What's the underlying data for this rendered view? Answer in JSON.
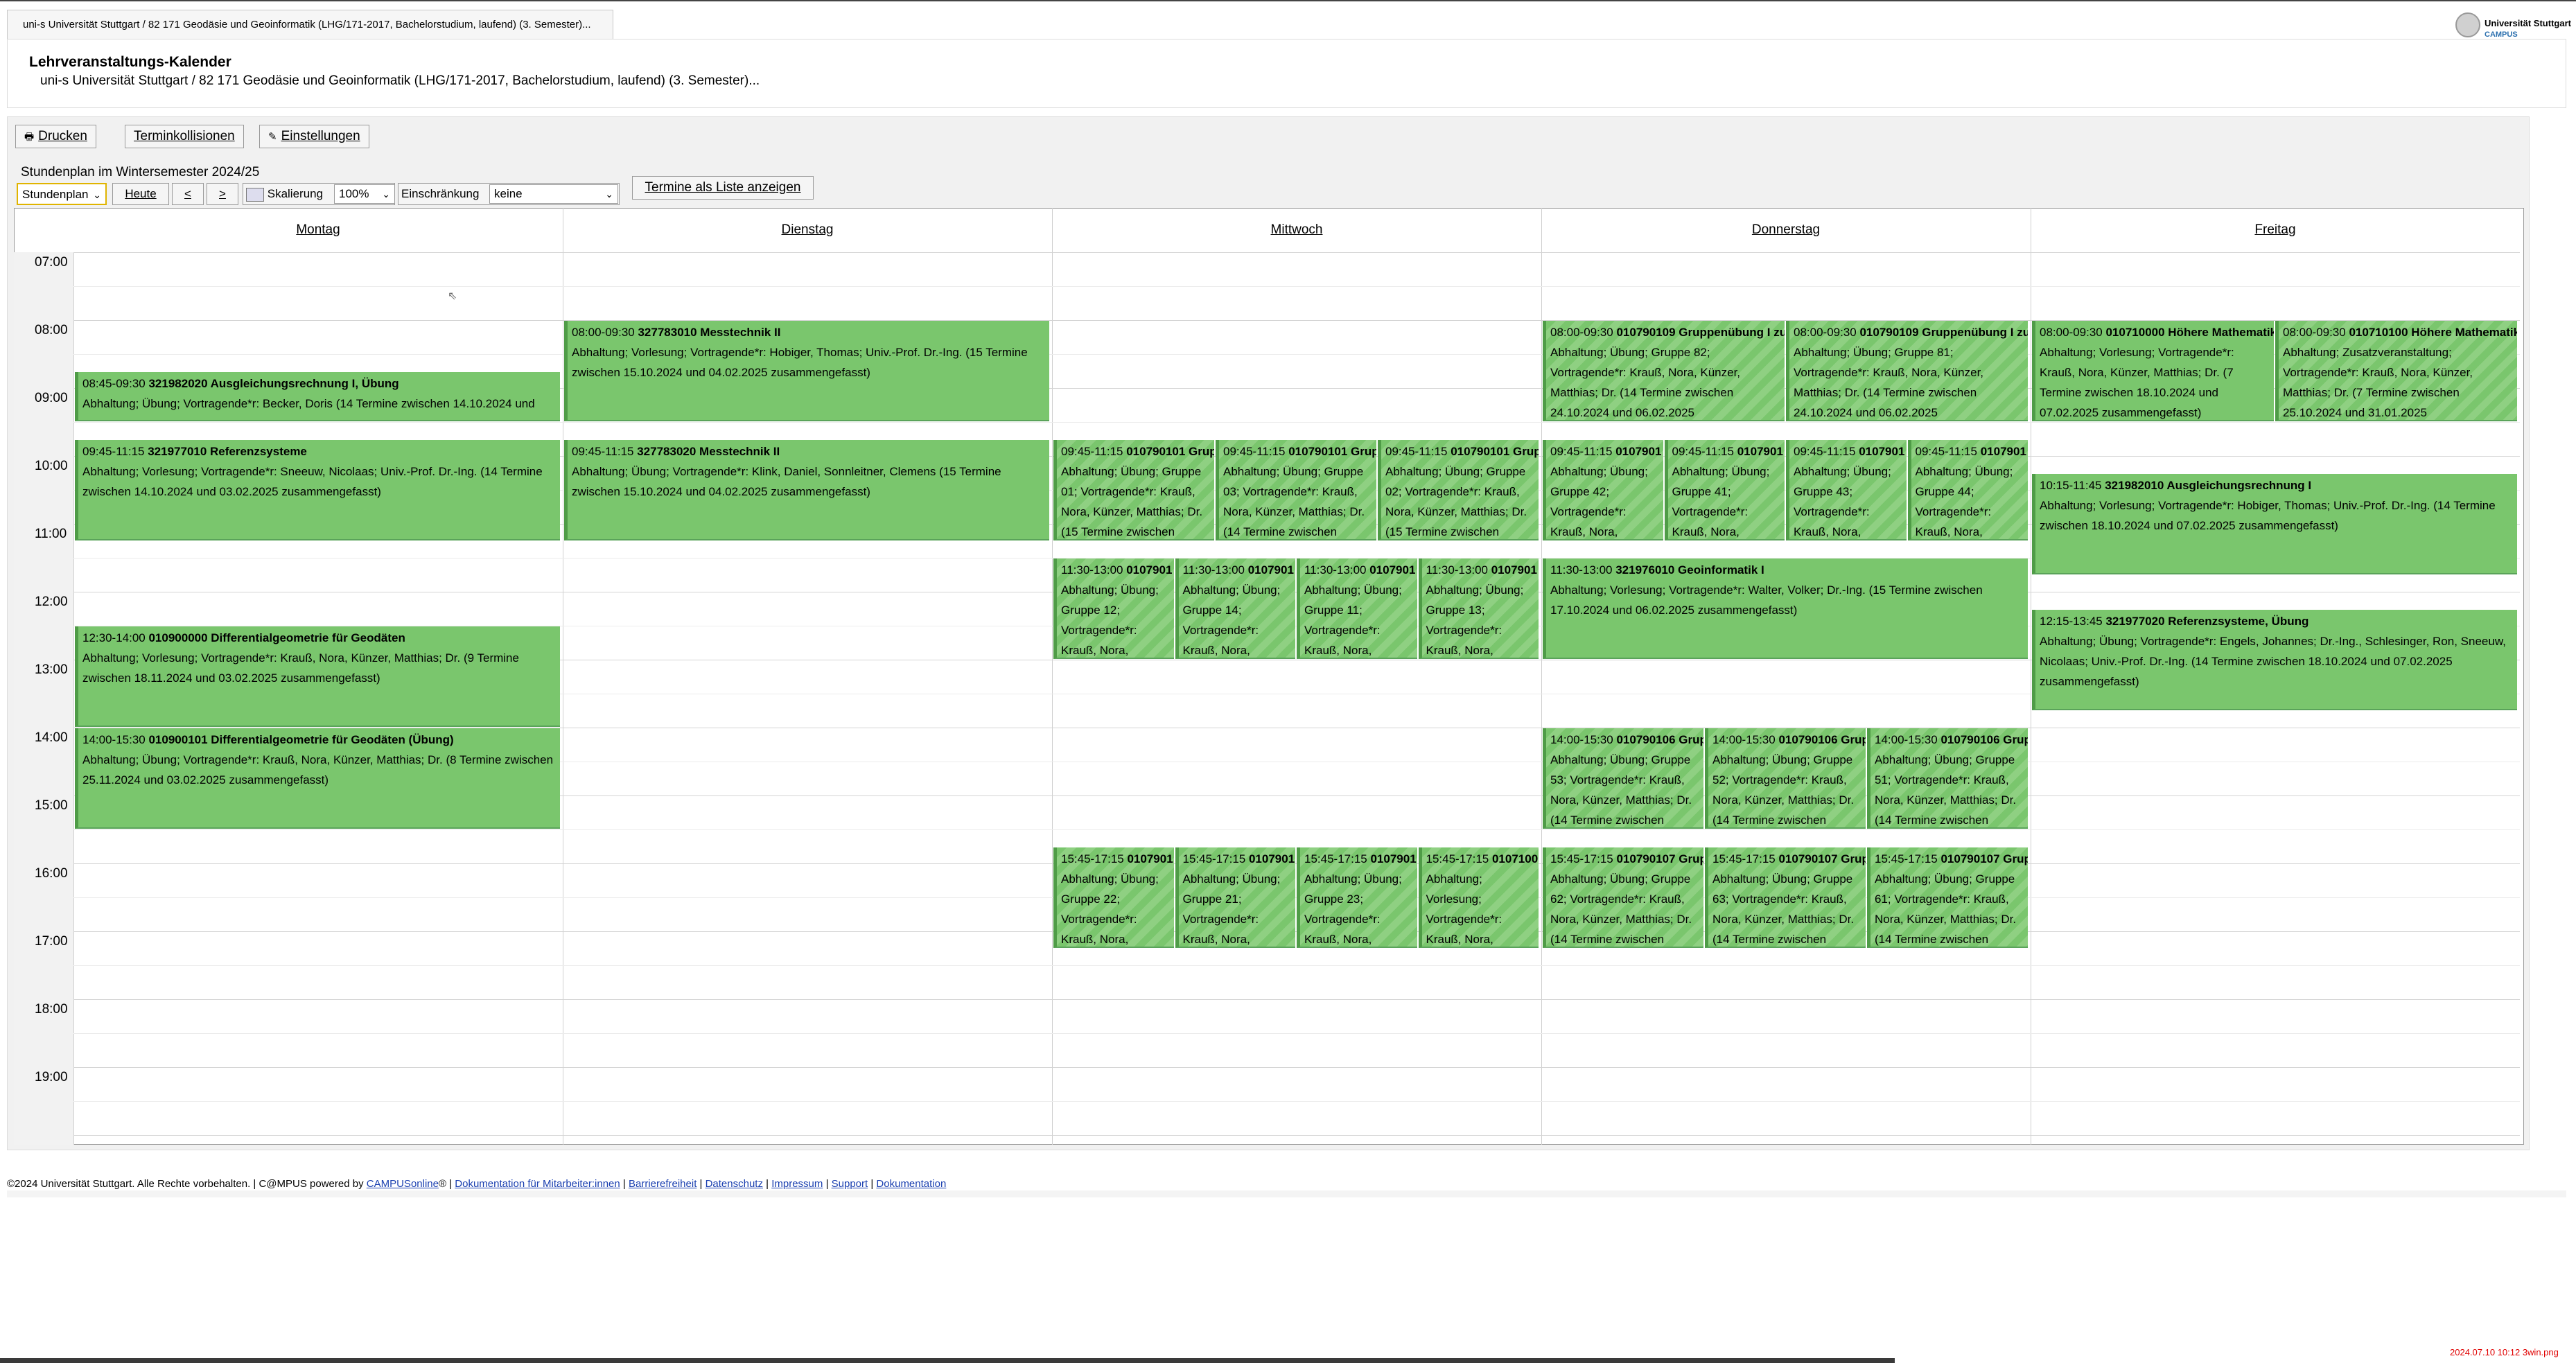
{
  "browser": {
    "tab_title": "uni-s Universität Stuttgart / 82 171 Geodäsie und Geoinformatik (LHG/171-2017, Bachelorstudium, laufend) (3. Semester)..."
  },
  "logo": {
    "line1": "Universität Stuttgart",
    "line2": "CAMPUS"
  },
  "header": {
    "title": "Lehrveranstaltungs-Kalender",
    "subtitle": "uni-s Universität Stuttgart / 82 171 Geodäsie und Geoinformatik (LHG/171-2017, Bachelorstudium, laufend) (3. Semester)..."
  },
  "toolbar": {
    "print_label": "Drucken",
    "conflicts_label": "Terminkollisionen",
    "settings_label": "Einstellungen"
  },
  "semester_label": "Stundenplan im Wintersemester 2024/25",
  "controls": {
    "view_select": "Stundenplan",
    "today_label": "Heute",
    "prev_label": "<",
    "next_label": ">",
    "scale_label": "Skalierung",
    "scale_value": "100%",
    "restriction_label": "Einschränkung",
    "restriction_value": "keine",
    "list_button": "Termine als Liste anzeigen"
  },
  "days": [
    "Montag",
    "Dienstag",
    "Mittwoch",
    "Donnerstag",
    "Freitag"
  ],
  "hours": [
    "07:00",
    "08:00",
    "09:00",
    "10:00",
    "11:00",
    "12:00",
    "13:00",
    "14:00",
    "15:00",
    "16:00",
    "17:00",
    "18:00",
    "19:00"
  ],
  "events": [
    {
      "day": 0,
      "start": "08:45",
      "end": "09:30",
      "col": 0,
      "cols": 1,
      "striped": false,
      "time": "08:45-09:30",
      "code": "321982020 Ausgleichungsrechnung I, Übung",
      "desc": "Abhaltung; Übung; Vortragende*r: Becker, Doris (14 Termine zwischen 14.10.2024 und"
    },
    {
      "day": 0,
      "start": "09:45",
      "end": "11:15",
      "col": 0,
      "cols": 1,
      "striped": false,
      "time": "09:45-11:15",
      "code": "321977010 Referenzsysteme",
      "desc": "Abhaltung; Vorlesung; Vortragende*r: Sneeuw, Nicolaas; Univ.-Prof. Dr.-Ing. (14 Termine zwischen 14.10.2024 und 03.02.2025 zusammengefasst)"
    },
    {
      "day": 0,
      "start": "12:30",
      "end": "14:00",
      "col": 0,
      "cols": 1,
      "striped": false,
      "time": "12:30-14:00",
      "code": "010900000 Differentialgeometrie für Geodäten",
      "desc": "Abhaltung; Vorlesung; Vortragende*r: Krauß, Nora, Künzer, Matthias; Dr. (9 Termine zwischen 18.11.2024 und 03.02.2025 zusammengefasst)"
    },
    {
      "day": 0,
      "start": "14:00",
      "end": "15:30",
      "col": 0,
      "cols": 1,
      "striped": false,
      "time": "14:00-15:30",
      "code": "010900101 Differentialgeometrie für Geodäten (Übung)",
      "desc": "Abhaltung; Übung; Vortragende*r: Krauß, Nora, Künzer, Matthias; Dr. (8 Termine zwischen 25.11.2024 und 03.02.2025 zusammengefasst)"
    },
    {
      "day": 1,
      "start": "08:00",
      "end": "09:30",
      "col": 0,
      "cols": 1,
      "striped": false,
      "time": "08:00-09:30",
      "code": "327783010 Messtechnik II",
      "desc": "Abhaltung; Vorlesung; Vortragende*r: Hobiger, Thomas; Univ.-Prof. Dr.-Ing. (15 Termine zwischen 15.10.2024 und 04.02.2025 zusammengefasst)"
    },
    {
      "day": 1,
      "start": "09:45",
      "end": "11:15",
      "col": 0,
      "cols": 1,
      "striped": false,
      "time": "09:45-11:15",
      "code": "327783020 Messtechnik II",
      "desc": "Abhaltung; Übung; Vortragende*r: Klink, Daniel, Sonnleitner, Clemens (15 Termine zwischen 15.10.2024 und 04.02.2025 zusammengefasst)"
    },
    {
      "day": 2,
      "start": "09:45",
      "end": "11:15",
      "col": 0,
      "cols": 3,
      "striped": true,
      "time": "09:45-11:15",
      "code": "010790101 Grup",
      "desc": "Abhaltung; Übung; Gruppe 01; Vortragende*r: Krauß, Nora, Künzer, Matthias; Dr. (15 Termine zwischen"
    },
    {
      "day": 2,
      "start": "09:45",
      "end": "11:15",
      "col": 1,
      "cols": 3,
      "striped": true,
      "time": "09:45-11:15",
      "code": "010790101 Grup",
      "desc": "Abhaltung; Übung; Gruppe 03; Vortragende*r: Krauß, Nora, Künzer, Matthias; Dr. (14 Termine zwischen"
    },
    {
      "day": 2,
      "start": "09:45",
      "end": "11:15",
      "col": 2,
      "cols": 3,
      "striped": true,
      "time": "09:45-11:15",
      "code": "010790101 Grup",
      "desc": "Abhaltung; Übung; Gruppe 02; Vortragende*r: Krauß, Nora, Künzer, Matthias; Dr. (15 Termine zwischen"
    },
    {
      "day": 2,
      "start": "11:30",
      "end": "13:00",
      "col": 0,
      "cols": 4,
      "striped": true,
      "time": "11:30-13:00",
      "code": "0107901",
      "desc": "Abhaltung; Übung; Gruppe 12; Vortragende*r: Krauß, Nora, Künzer,"
    },
    {
      "day": 2,
      "start": "11:30",
      "end": "13:00",
      "col": 1,
      "cols": 4,
      "striped": true,
      "time": "11:30-13:00",
      "code": "0107901",
      "desc": "Abhaltung; Übung; Gruppe 14; Vortragende*r: Krauß, Nora, Künzer,"
    },
    {
      "day": 2,
      "start": "11:30",
      "end": "13:00",
      "col": 2,
      "cols": 4,
      "striped": true,
      "time": "11:30-13:00",
      "code": "0107901",
      "desc": "Abhaltung; Übung; Gruppe 11; Vortragende*r: Krauß, Nora, Künzer,"
    },
    {
      "day": 2,
      "start": "11:30",
      "end": "13:00",
      "col": 3,
      "cols": 4,
      "striped": true,
      "time": "11:30-13:00",
      "code": "0107901",
      "desc": "Abhaltung; Übung; Gruppe 13; Vortragende*r: Krauß, Nora, Künzer,"
    },
    {
      "day": 2,
      "start": "15:45",
      "end": "17:15",
      "col": 0,
      "cols": 4,
      "striped": true,
      "time": "15:45-17:15",
      "code": "0107901",
      "desc": "Abhaltung; Übung; Gruppe 22; Vortragende*r: Krauß, Nora, Künzer,"
    },
    {
      "day": 2,
      "start": "15:45",
      "end": "17:15",
      "col": 1,
      "cols": 4,
      "striped": true,
      "time": "15:45-17:15",
      "code": "0107901",
      "desc": "Abhaltung; Übung; Gruppe 21; Vortragende*r: Krauß, Nora, Künzer,"
    },
    {
      "day": 2,
      "start": "15:45",
      "end": "17:15",
      "col": 2,
      "cols": 4,
      "striped": true,
      "time": "15:45-17:15",
      "code": "0107901",
      "desc": "Abhaltung; Übung; Gruppe 23; Vortragende*r: Krauß, Nora, Künzer,"
    },
    {
      "day": 2,
      "start": "15:45",
      "end": "17:15",
      "col": 3,
      "cols": 4,
      "striped": true,
      "time": "15:45-17:15",
      "code": "0107100",
      "desc": "Abhaltung; Vorlesung; Vortragende*r: Krauß, Nora, Künzer,"
    },
    {
      "day": 3,
      "start": "08:00",
      "end": "09:30",
      "col": 0,
      "cols": 2,
      "striped": true,
      "time": "08:00-09:30",
      "code": "010790109 Gruppenübung I zu",
      "desc": "Abhaltung; Übung; Gruppe 82; Vortragende*r: Krauß, Nora, Künzer, Matthias; Dr. (14 Termine zwischen 24.10.2024 und 06.02.2025"
    },
    {
      "day": 3,
      "start": "08:00",
      "end": "09:30",
      "col": 1,
      "cols": 2,
      "striped": true,
      "time": "08:00-09:30",
      "code": "010790109 Gruppenübung I zu",
      "desc": "Abhaltung; Übung; Gruppe 81; Vortragende*r: Krauß, Nora, Künzer, Matthias; Dr. (14 Termine zwischen 24.10.2024 und 06.02.2025"
    },
    {
      "day": 3,
      "start": "09:45",
      "end": "11:15",
      "col": 0,
      "cols": 4,
      "striped": true,
      "time": "09:45-11:15",
      "code": "0107901",
      "desc": "Abhaltung; Übung; Gruppe 42; Vortragende*r: Krauß, Nora, Künzer,"
    },
    {
      "day": 3,
      "start": "09:45",
      "end": "11:15",
      "col": 1,
      "cols": 4,
      "striped": true,
      "time": "09:45-11:15",
      "code": "0107901",
      "desc": "Abhaltung; Übung; Gruppe 41; Vortragende*r: Krauß, Nora, Künzer,"
    },
    {
      "day": 3,
      "start": "09:45",
      "end": "11:15",
      "col": 2,
      "cols": 4,
      "striped": true,
      "time": "09:45-11:15",
      "code": "0107901",
      "desc": "Abhaltung; Übung; Gruppe 43; Vortragende*r: Krauß, Nora, Künzer,"
    },
    {
      "day": 3,
      "start": "09:45",
      "end": "11:15",
      "col": 3,
      "cols": 4,
      "striped": true,
      "time": "09:45-11:15",
      "code": "0107901",
      "desc": "Abhaltung; Übung; Gruppe 44; Vortragende*r: Krauß, Nora, Künzer,"
    },
    {
      "day": 3,
      "start": "11:30",
      "end": "13:00",
      "col": 0,
      "cols": 1,
      "striped": false,
      "time": "11:30-13:00",
      "code": "321976010 Geoinformatik I",
      "desc": "Abhaltung; Vorlesung; Vortragende*r: Walter, Volker; Dr.-Ing. (15 Termine zwischen 17.10.2024 und 06.02.2025 zusammengefasst)"
    },
    {
      "day": 3,
      "start": "14:00",
      "end": "15:30",
      "col": 0,
      "cols": 3,
      "striped": true,
      "time": "14:00-15:30",
      "code": "010790106 Grup",
      "desc": "Abhaltung; Übung; Gruppe 53; Vortragende*r: Krauß, Nora, Künzer, Matthias; Dr. (14 Termine zwischen"
    },
    {
      "day": 3,
      "start": "14:00",
      "end": "15:30",
      "col": 1,
      "cols": 3,
      "striped": true,
      "time": "14:00-15:30",
      "code": "010790106 Grup",
      "desc": "Abhaltung; Übung; Gruppe 52; Vortragende*r: Krauß, Nora, Künzer, Matthias; Dr. (14 Termine zwischen"
    },
    {
      "day": 3,
      "start": "14:00",
      "end": "15:30",
      "col": 2,
      "cols": 3,
      "striped": true,
      "time": "14:00-15:30",
      "code": "010790106 Grup",
      "desc": "Abhaltung; Übung; Gruppe 51; Vortragende*r: Krauß, Nora, Künzer, Matthias; Dr. (14 Termine zwischen"
    },
    {
      "day": 3,
      "start": "15:45",
      "end": "17:15",
      "col": 0,
      "cols": 3,
      "striped": true,
      "time": "15:45-17:15",
      "code": "010790107 Grup",
      "desc": "Abhaltung; Übung; Gruppe 62; Vortragende*r: Krauß, Nora, Künzer, Matthias; Dr. (14 Termine zwischen"
    },
    {
      "day": 3,
      "start": "15:45",
      "end": "17:15",
      "col": 1,
      "cols": 3,
      "striped": true,
      "time": "15:45-17:15",
      "code": "010790107 Grup",
      "desc": "Abhaltung; Übung; Gruppe 63; Vortragende*r: Krauß, Nora, Künzer, Matthias; Dr. (14 Termine zwischen"
    },
    {
      "day": 3,
      "start": "15:45",
      "end": "17:15",
      "col": 2,
      "cols": 3,
      "striped": true,
      "time": "15:45-17:15",
      "code": "010790107 Grup",
      "desc": "Abhaltung; Übung; Gruppe 61; Vortragende*r: Krauß, Nora, Künzer, Matthias; Dr. (14 Termine zwischen"
    },
    {
      "day": 4,
      "start": "08:00",
      "end": "09:30",
      "col": 0,
      "cols": 2,
      "striped": false,
      "time": "08:00-09:30",
      "code": "010710000 Höhere Mathematik",
      "desc": "Abhaltung; Vorlesung; Vortragende*r: Krauß, Nora, Künzer, Matthias; Dr. (7 Termine zwischen 18.10.2024 und 07.02.2025 zusammengefasst)"
    },
    {
      "day": 4,
      "start": "08:00",
      "end": "09:30",
      "col": 1,
      "cols": 2,
      "striped": true,
      "time": "08:00-09:30",
      "code": "010710100 Höhere Mathematik",
      "desc": "Abhaltung; Zusatzveranstaltung; Vortragende*r: Krauß, Nora, Künzer, Matthias; Dr. (7 Termine zwischen 25.10.2024 und 31.01.2025"
    },
    {
      "day": 4,
      "start": "10:15",
      "end": "11:45",
      "col": 0,
      "cols": 1,
      "striped": false,
      "time": "10:15-11:45",
      "code": "321982010 Ausgleichungsrechnung I",
      "desc": "Abhaltung; Vorlesung; Vortragende*r: Hobiger, Thomas; Univ.-Prof. Dr.-Ing. (14 Termine zwischen 18.10.2024 und 07.02.2025 zusammengefasst)"
    },
    {
      "day": 4,
      "start": "12:15",
      "end": "13:45",
      "col": 0,
      "cols": 1,
      "striped": false,
      "time": "12:15-13:45",
      "code": "321977020 Referenzsysteme, Übung",
      "desc": "Abhaltung; Übung; Vortragende*r: Engels, Johannes; Dr.-Ing., Schlesinger, Ron, Sneeuw, Nicolaas; Univ.-Prof. Dr.-Ing. (14 Termine zwischen 18.10.2024 und 07.02.2025 zusammengefasst)"
    }
  ],
  "footer": {
    "copyright": "©2024 Universität Stuttgart. Alle Rechte vorbehalten. | C@MPUS powered by ",
    "links": [
      "CAMPUSonline",
      "Dokumentation für Mitarbeiter:innen",
      "Barrierefreiheit",
      "Datenschutz",
      "Impressum",
      "Support",
      "Dokumentation"
    ],
    "registered": "®"
  },
  "screenshot_stamp": "2024.07.10  10:12  3win.png"
}
